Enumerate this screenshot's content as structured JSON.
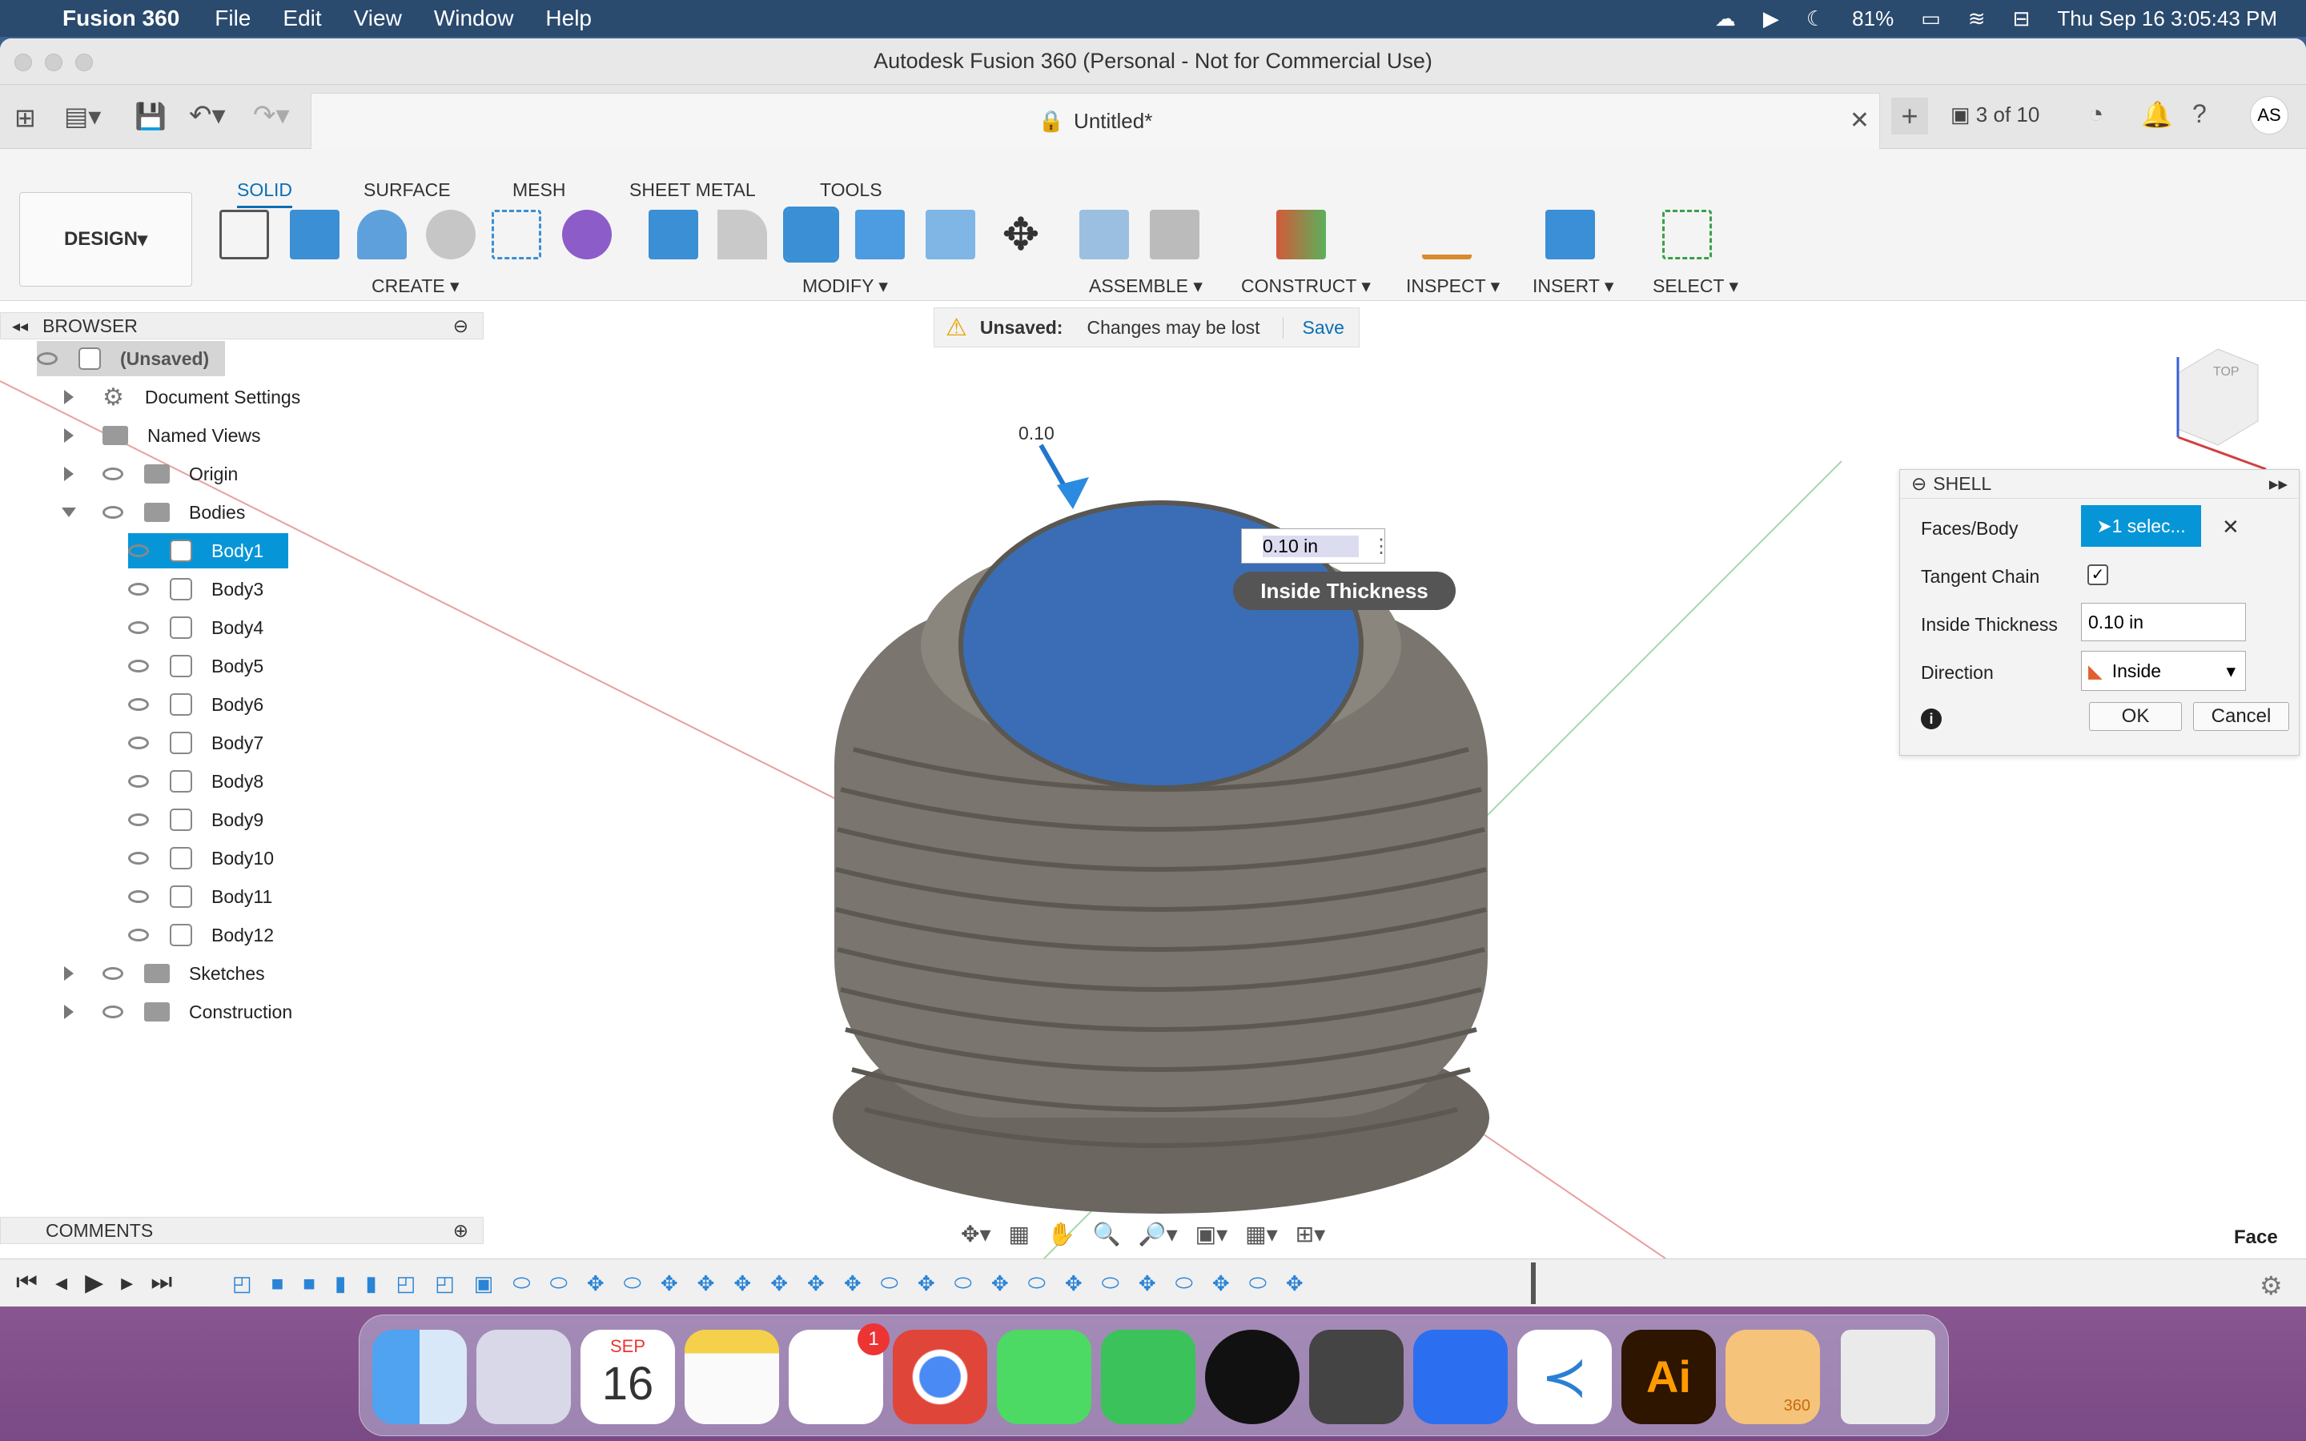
{
  "menubar": {
    "app": "Fusion 360",
    "items": [
      "File",
      "Edit",
      "View",
      "Window",
      "Help"
    ],
    "battery": "81%",
    "datetime": "Thu Sep 16  3:05:43 PM"
  },
  "window": {
    "title": "Autodesk Fusion 360 (Personal - Not for Commercial Use)",
    "doc_tab": "Untitled*",
    "version": "3 of 10",
    "user": "AS"
  },
  "toolbar": {
    "workspace": "DESIGN",
    "tabs": [
      "SOLID",
      "SURFACE",
      "MESH",
      "SHEET METAL",
      "TOOLS"
    ],
    "groups": [
      "CREATE",
      "MODIFY",
      "ASSEMBLE",
      "CONSTRUCT",
      "INSPECT",
      "INSERT",
      "SELECT"
    ]
  },
  "unsaved": {
    "label": "Unsaved:",
    "message": "Changes may be lost",
    "save": "Save"
  },
  "browser": {
    "title": "BROWSER",
    "root": "(Unsaved)",
    "items": [
      "Document Settings",
      "Named Views",
      "Origin",
      "Bodies",
      "Sketches",
      "Construction"
    ],
    "bodies": [
      "Body1",
      "Body3",
      "Body4",
      "Body5",
      "Body6",
      "Body7",
      "Body8",
      "Body9",
      "Body10",
      "Body11",
      "Body12"
    ],
    "comments": "COMMENTS"
  },
  "canvas": {
    "value_input": "0.10 in",
    "tooltip": "Inside Thickness",
    "dim_label": "0.10",
    "viewcube": "TOP",
    "selection": "Face"
  },
  "shell": {
    "title": "SHELL",
    "faces_label": "Faces/Body",
    "faces_value": "1 selec...",
    "tangent_label": "Tangent Chain",
    "thickness_label": "Inside Thickness",
    "thickness_value": "0.10 in",
    "direction_label": "Direction",
    "direction_value": "Inside",
    "ok": "OK",
    "cancel": "Cancel"
  },
  "dock": {
    "calendar_month": "SEP",
    "calendar_day": "16",
    "badge": "1",
    "ai": "Ai",
    "f360": "360"
  },
  "colors": {
    "accent": "#0696d7",
    "face_blue": "#3a6db5",
    "body": "#7a756e"
  }
}
